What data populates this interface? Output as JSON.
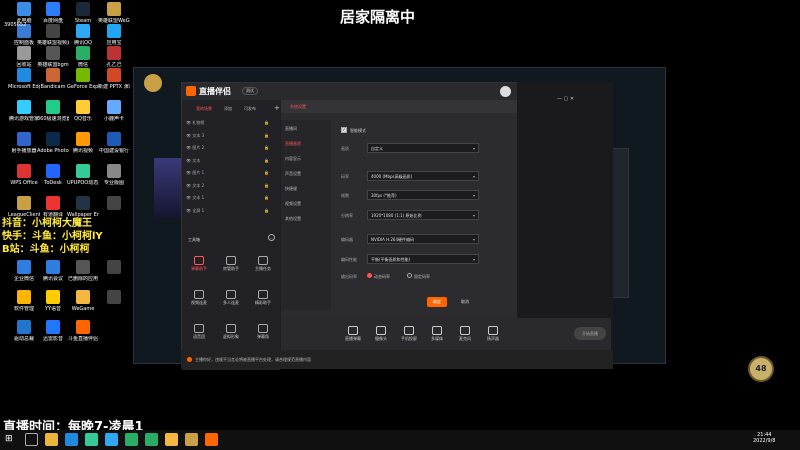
{
  "overlay": {
    "stream_title": "居家隔离中",
    "douyin": "抖音：小柯柯大魔王",
    "kuaishou": "快手：斗鱼：小柯柯lY",
    "bilibili": "B站：斗鱼：小柯柯",
    "live_time": "直播时间：每晚7-凌晨1",
    "profile_id": "3905652"
  },
  "desktop_icons": [
    {
      "label": "此电脑",
      "color": "#3a8ee6"
    },
    {
      "label": "百度网盘",
      "color": "#2b7fff"
    },
    {
      "label": "Steam",
      "color": "#1b2838"
    },
    {
      "label": "英雄联盟WeGame版",
      "color": "#c8a046"
    },
    {
      "label": "控制面板",
      "color": "#3a7bd5"
    },
    {
      "label": "英雄联盟视频素材",
      "color": "#444"
    },
    {
      "label": "腾讯QQ",
      "color": "#2fa9f4"
    },
    {
      "label": "应用宝",
      "color": "#22a6f2"
    },
    {
      "label": "回收站",
      "color": "#999"
    },
    {
      "label": "英雄联盟bgm",
      "color": "#555"
    },
    {
      "label": "微信",
      "color": "#2aae67"
    },
    {
      "label": "孔乙己",
      "color": "#b33"
    },
    {
      "label": "Microsoft Edge",
      "color": "#1f8be0"
    },
    {
      "label": "Bandicam",
      "color": "#c63"
    },
    {
      "label": "GeForce Experience",
      "color": "#76b900"
    },
    {
      "label": "新建 PPTX 演示文稿",
      "color": "#d24726"
    },
    {
      "label": "腾讯游戏管家",
      "color": "#3cf"
    },
    {
      "label": "360极速浏览器",
      "color": "#2c8"
    },
    {
      "label": "QQ音乐",
      "color": "#fc3"
    },
    {
      "label": "小鹿声卡",
      "color": "#6af"
    },
    {
      "label": "射手播放器",
      "color": "#36c"
    },
    {
      "label": "Adobe Photoshop",
      "color": "#0b2a4a"
    },
    {
      "label": "腾讯视频",
      "color": "#f90"
    },
    {
      "label": "中国建设银行",
      "color": "#1d5bb6"
    },
    {
      "label": "WPS Office",
      "color": "#d33"
    },
    {
      "label": "ToDesk",
      "color": "#26f"
    },
    {
      "label": "UPUPOO动态桌面",
      "color": "#3c9"
    },
    {
      "label": "专业版图",
      "color": "#888"
    },
    {
      "label": "LeagueClient",
      "color": "#c8a046"
    },
    {
      "label": "有道翻译",
      "color": "#e33"
    },
    {
      "label": "Wallpaper Engine",
      "color": "#234"
    },
    {
      "label": "",
      "color": "#444"
    },
    {
      "label": "企业微信",
      "color": "#2f7de1"
    },
    {
      "label": "腾讯会议",
      "color": "#2f7de1"
    },
    {
      "label": "已删除的应用",
      "color": "#555"
    },
    {
      "label": "",
      "color": "#444"
    },
    {
      "label": "软件管理",
      "color": "#ffb400"
    },
    {
      "label": "YY语音",
      "color": "#fc0"
    },
    {
      "label": "WeGame",
      "color": "#f4b73f"
    },
    {
      "label": "",
      "color": "#444"
    },
    {
      "label": "驱动总裁",
      "color": "#27c"
    },
    {
      "label": "迅雷影音",
      "color": "#27f"
    },
    {
      "label": "斗鱼直播伴侣",
      "color": "#f60"
    }
  ],
  "app": {
    "brand": "直播伴侣",
    "beta": "测试",
    "tabs": [
      "我的场景",
      "添加",
      "可发布"
    ],
    "layers": [
      "礼物榜",
      "文本 3",
      "图片 2",
      "文本",
      "图片 1",
      "文本 2",
      "文本 1",
      "全屏 1"
    ],
    "tools_title": "工具箱",
    "tools": [
      "弹幕助手",
      "房管助手",
      "主播任务",
      "视频连麦",
      "多人连麦",
      "精彩助手",
      "语音团",
      "虚拟形象",
      "弹幕角"
    ],
    "settings": {
      "header": "系统设置",
      "side": [
        "直播间",
        "直播画质",
        "内容显示",
        "声音设置",
        "快捷键",
        "视频设置",
        "其他设置"
      ],
      "checkbox": "智能模式",
      "rows": [
        {
          "label": "画质",
          "value": "自定义"
        },
        {
          "label": "码率",
          "value": "4000 (Mbps高级画质)"
        },
        {
          "label": "帧数",
          "value": "30fps (*推荐)"
        },
        {
          "label": "分辨率",
          "value": "1920*1080 (1:1) 原始比例"
        },
        {
          "label": "编码器",
          "value": "NVIDIA H.264硬件编码"
        },
        {
          "label": "编码性能",
          "value": "平衡(平衡画质和性能)"
        }
      ],
      "radio_label": "输出码率",
      "radio_opts": [
        "动态码率",
        "固定码率"
      ],
      "confirm": "确定",
      "cancel": "取消"
    },
    "bottom": [
      "直播弹幕",
      "摄像头",
      "手机投屏",
      "多媒体",
      "麦克风",
      "扬声器"
    ],
    "start_btn": "开始直播",
    "notice": "主播你好，违规不当言论将被直播平台处理，请合理规范直播内容"
  },
  "clock": {
    "time": "21:44",
    "date": "2022/9/8"
  },
  "level_badge": "48"
}
